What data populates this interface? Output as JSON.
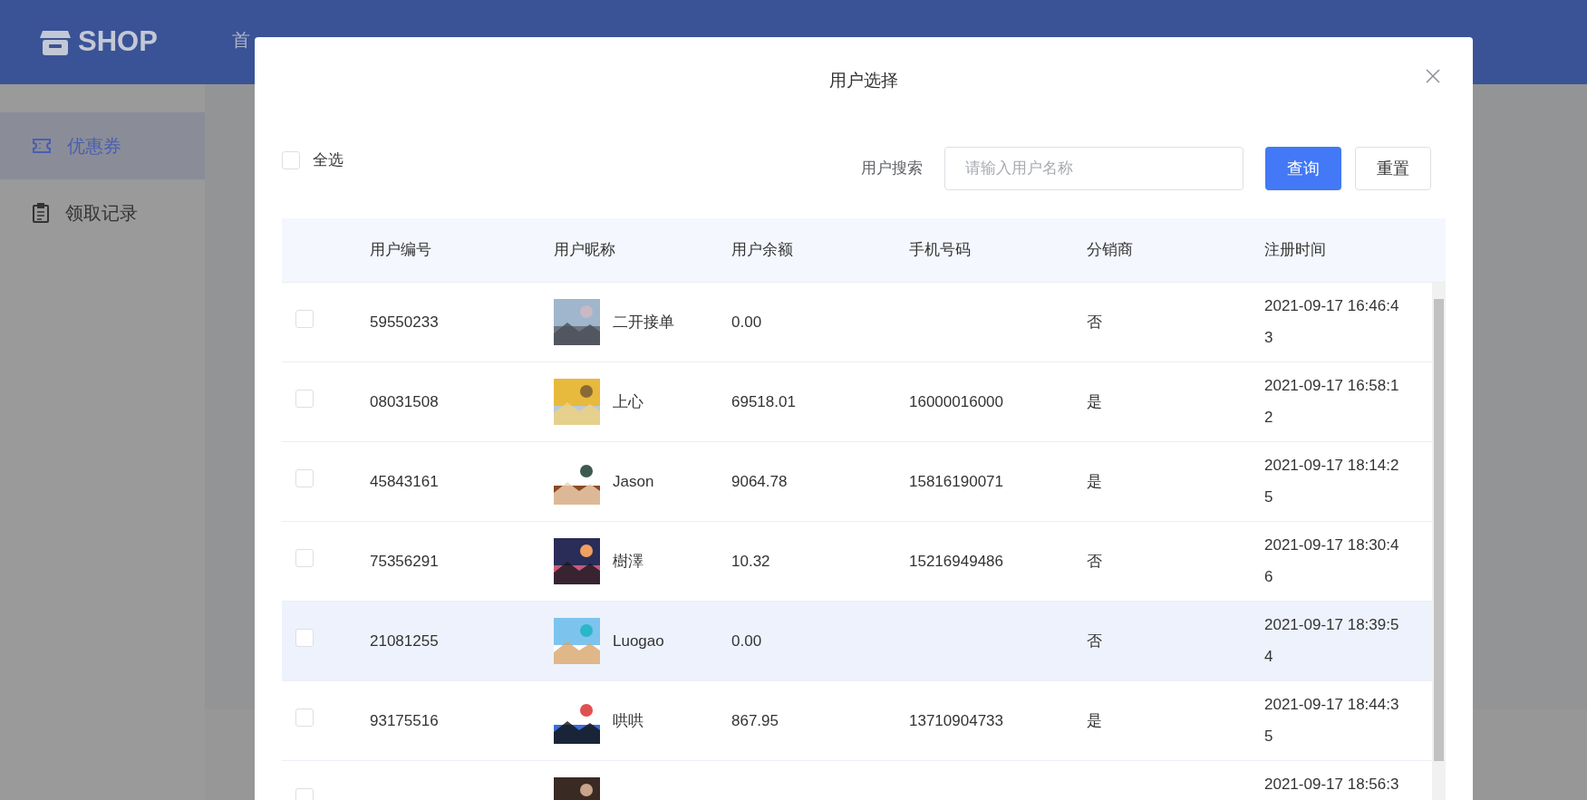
{
  "header": {
    "logo": "SHOP",
    "nav": [
      "首"
    ]
  },
  "sidebar": {
    "items": [
      {
        "label": "优惠券",
        "kind": "ticket",
        "selected": true
      },
      {
        "label": "领取记录",
        "kind": "clipboard",
        "selected": false
      }
    ]
  },
  "dialog": {
    "title": "用户选择",
    "select_all": {
      "label": "全选",
      "checked": false
    },
    "search": {
      "label": "用户搜索",
      "placeholder": "请输入用户名称"
    },
    "buttons": [
      {
        "label": "查询",
        "kind": "primary"
      },
      {
        "label": "重置",
        "kind": "default"
      }
    ],
    "table": {
      "columns": [
        "用户编号",
        "用户昵称",
        "用户余额",
        "手机号码",
        "分销商",
        "注册时间"
      ],
      "rows": [
        {
          "id": "59550233",
          "nickname": "二开接单",
          "balance": "0.00",
          "distributor": "否",
          "registered": "2021-09-17 16:46:43",
          "checked": false,
          "highlighted": false
        },
        {
          "id": "08031508",
          "nickname": "上心",
          "balance": "69518.01",
          "phone": "16000016000",
          "distributor": "是",
          "registered": "2021-09-17 16:58:12",
          "checked": false,
          "highlighted": false
        },
        {
          "id": "45843161",
          "nickname": "Jason",
          "balance": "9064.78",
          "phone": "15816190071",
          "distributor": "是",
          "registered": "2021-09-17 18:14:25",
          "checked": false,
          "highlighted": false
        },
        {
          "id": "75356291",
          "nickname": "樹澤",
          "balance": "10.32",
          "phone": "15216949486",
          "distributor": "否",
          "registered": "2021-09-17 18:30:46",
          "checked": false,
          "highlighted": false
        },
        {
          "id": "21081255",
          "nickname": "Luogao",
          "balance": "0.00",
          "distributor": "否",
          "registered": "2021-09-17 18:39:54",
          "checked": false,
          "highlighted": true
        },
        {
          "id": "93175516",
          "nickname": "哄哄",
          "balance": "867.95",
          "phone": "13710904733",
          "distributor": "是",
          "registered": "2021-09-17 18:44:35",
          "checked": false,
          "highlighted": false
        },
        {
          "registered": "2021-09-17 18:56:3",
          "checked": false,
          "highlighted": false
        }
      ]
    }
  }
}
